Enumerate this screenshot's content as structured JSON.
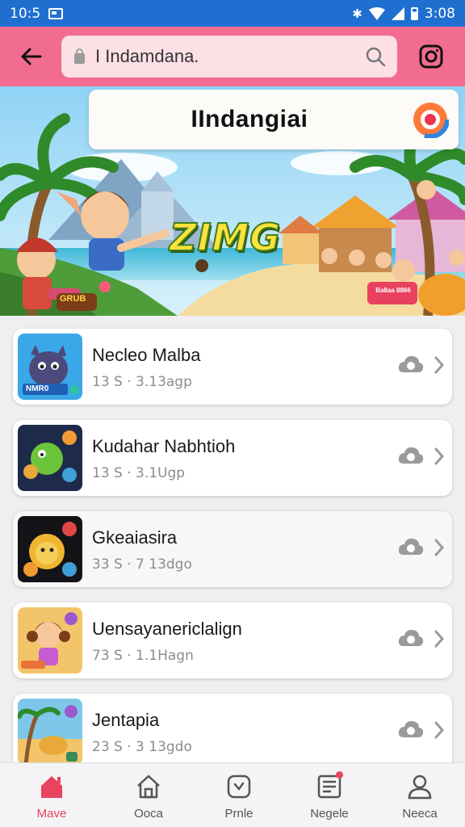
{
  "status_bar": {
    "time": "10:5",
    "right_time": "3:08",
    "icons": [
      "image-icon",
      "bluetooth-icon",
      "wifi-icon",
      "signal-icon",
      "battery-icon"
    ]
  },
  "app_bar": {
    "back_icon": "arrow-left-icon",
    "url_text": "I Indamdana.",
    "lock_icon": "lock-icon",
    "search_icon": "search-icon",
    "menu_icon": "instagram-icon",
    "accent_color": "#f26c8f"
  },
  "hero": {
    "title": "IIndangiai",
    "headline": "ZIMG",
    "badge": "GRUB",
    "tag": "Ba8aa 8866",
    "logo_icon": "circle-logo-icon"
  },
  "list": {
    "items": [
      {
        "title": "Necleo Malba",
        "subtitle": "13 S · 3.13agp",
        "thumb_label": "NMR0",
        "thumb_icon": "creature-icon"
      },
      {
        "title": "Kudahar Nabhtioh",
        "subtitle": "13 S · 3.1Ugp",
        "thumb_label": "",
        "thumb_icon": "ball-icon"
      },
      {
        "title": "Gkeaiasira",
        "subtitle": "33 S · 7 13dgo",
        "thumb_label": "",
        "thumb_icon": "lion-icon"
      },
      {
        "title": "Uensayanericlalign",
        "subtitle": "73 S · 1.1Hagn",
        "thumb_label": "",
        "thumb_icon": "girl-icon"
      },
      {
        "title": "Jentapia",
        "subtitle": "23 S · 3 13gdo",
        "thumb_label": "",
        "thumb_icon": "beach-icon"
      }
    ],
    "item_action_icon": "cloud-icon",
    "item_chevron_icon": "chevron-right-icon"
  },
  "bottom_nav": {
    "items": [
      {
        "label": "Mave",
        "icon": "home-filled-icon",
        "active": true
      },
      {
        "label": "Ooca",
        "icon": "home-outline-icon",
        "active": false
      },
      {
        "label": "Prnle",
        "icon": "chat-icon",
        "active": false
      },
      {
        "label": "Negele",
        "icon": "news-icon",
        "active": false
      },
      {
        "label": "Neeca",
        "icon": "person-icon",
        "active": false
      }
    ],
    "active_color": "#e8445f"
  }
}
